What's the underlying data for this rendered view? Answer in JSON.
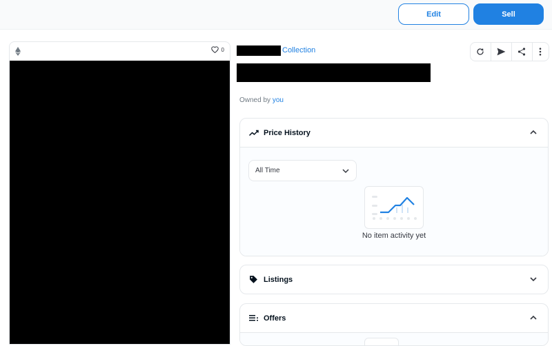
{
  "header": {
    "edit_label": "Edit",
    "sell_label": "Sell"
  },
  "asset": {
    "favorite_count": "0",
    "collection_link": "Collection",
    "owned_by_prefix": "Owned by",
    "owner": "you"
  },
  "toolbar": {
    "icons": [
      "refresh-icon",
      "send-icon",
      "share-icon",
      "more-icon"
    ]
  },
  "price_history": {
    "title": "Price History",
    "time_filter": "All Time",
    "empty_message": "No item activity yet"
  },
  "listings": {
    "title": "Listings"
  },
  "offers": {
    "title": "Offers"
  },
  "colors": {
    "accent": "#2081e2",
    "text": "#04111d",
    "muted": "#707a83",
    "border": "#e5e8eb"
  }
}
